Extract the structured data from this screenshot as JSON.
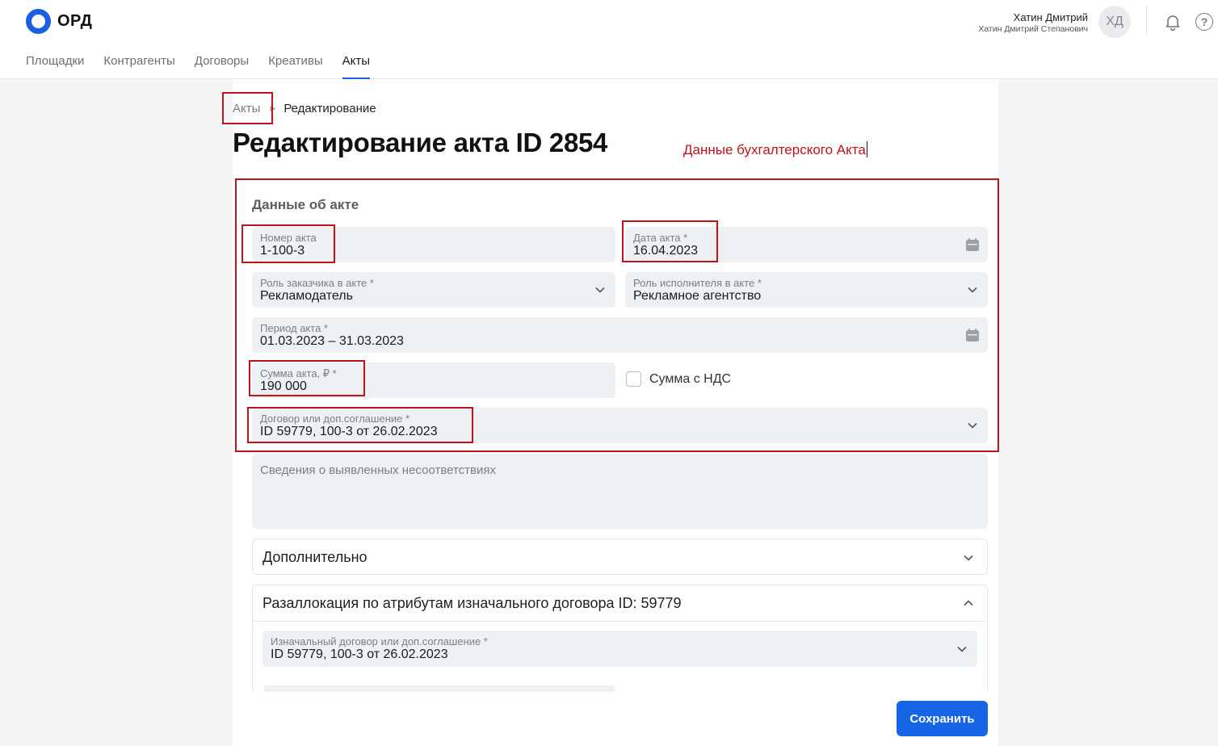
{
  "app": {
    "name": "ОРД"
  },
  "nav": {
    "items": [
      {
        "label": "Площадки"
      },
      {
        "label": "Контрагенты"
      },
      {
        "label": "Договоры"
      },
      {
        "label": "Креативы"
      },
      {
        "label": "Акты",
        "active": true
      }
    ]
  },
  "user": {
    "short_name": "Хатин Дмитрий",
    "full_name": "Хатин Дмитрий Степанович",
    "initials": "ХД"
  },
  "icons": {
    "notifications": "bell-icon",
    "help": "help-icon",
    "help_glyph": "?"
  },
  "breadcrumb": {
    "parent": "Акты",
    "current": "Редактирование"
  },
  "page": {
    "title": "Редактирование акта ID 2854"
  },
  "annotation": "Данные бухгалтерского Акта",
  "form": {
    "section_title": "Данные об акте",
    "act_number": {
      "label": "Номер акта",
      "value": "1-100-3"
    },
    "act_date": {
      "label": "Дата акта *",
      "value": "16.04.2023"
    },
    "customer_role": {
      "label": "Роль заказчика в акте *",
      "value": "Рекламодатель"
    },
    "executor_role": {
      "label": "Роль исполнителя в акте *",
      "value": "Рекламное агентство"
    },
    "period": {
      "label": "Период акта *",
      "value": "01.03.2023 – 31.03.2023"
    },
    "amount": {
      "label": "Сумма акта, ₽ *",
      "value": "190 000"
    },
    "vat": {
      "label": "Сумма с НДС",
      "checked": false
    },
    "contract": {
      "label": "Договор или доп.соглашение *",
      "value": "ID 59779, 100-3 от 26.02.2023"
    },
    "discrepancies": {
      "placeholder": "Сведения о выявленных несоответствиях"
    }
  },
  "panels": {
    "additional": {
      "title": "Дополнительно",
      "expanded": false
    },
    "reallocation": {
      "title": "Разаллокация по атрибутам изначального договора ID: 59779",
      "expanded": true,
      "original_contract": {
        "label": "Изначальный договор или доп.соглашение *",
        "value": "ID 59779, 100-3 от 26.02.2023"
      }
    }
  },
  "actions": {
    "save_label": "Сохранить"
  },
  "colors": {
    "accent": "#1565e6",
    "annotation_red": "#c41018",
    "field_bg": "#eef1f4"
  }
}
